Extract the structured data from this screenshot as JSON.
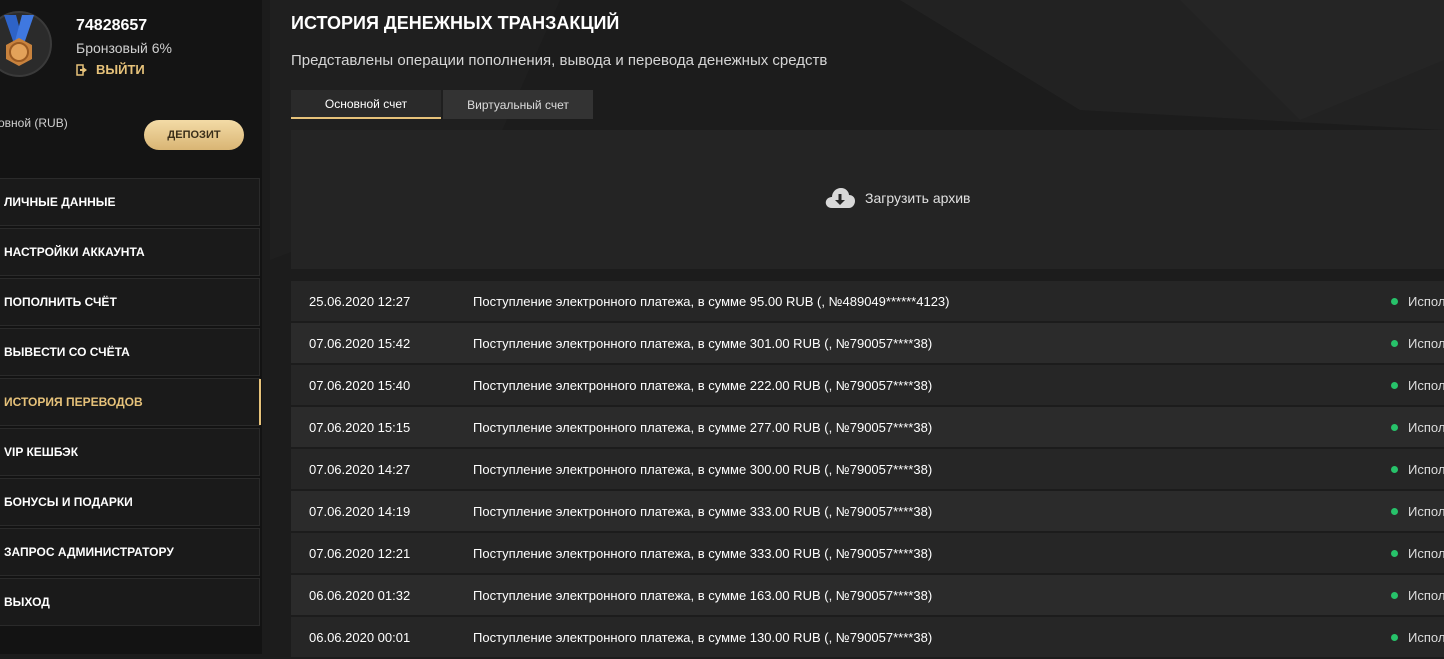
{
  "profile": {
    "user_id": "74828657",
    "level": "Бронзовый 6%",
    "logout_label": "ВЫЙТИ",
    "account_label": "овной (RUB)",
    "deposit_label": "ДЕПОЗИТ"
  },
  "nav": {
    "items": [
      {
        "label": "ЛИЧНЫЕ ДАННЫЕ"
      },
      {
        "label": "НАСТРОЙКИ АККАУНТА"
      },
      {
        "label": "ПОПОЛНИТЬ СЧЁТ"
      },
      {
        "label": "ВЫВЕСТИ СО СЧЁТА"
      },
      {
        "label": "ИСТОРИЯ ПЕРЕВОДОВ"
      },
      {
        "label": "VIP КЕШБЭК"
      },
      {
        "label": "БОНУСЫ И ПОДАРКИ"
      },
      {
        "label": "ЗАПРОС АДМИНИСТРАТОРУ"
      },
      {
        "label": "ВЫХОД"
      }
    ],
    "active_index": 4
  },
  "main": {
    "title": "ИСТОРИЯ ДЕНЕЖНЫХ ТРАНЗАКЦИЙ",
    "subtitle": "Представлены операции пополнения, вывода и перевода денежных средств",
    "tabs": [
      {
        "label": "Основной счет"
      },
      {
        "label": "Виртуальный счет"
      }
    ],
    "archive_label": "Загрузить архив"
  },
  "transactions": [
    {
      "date": "25.06.2020 12:27",
      "description": "Поступление электронного платежа, в сумме 95.00 RUB (, №489049******4123)",
      "status": "Испол"
    },
    {
      "date": "07.06.2020 15:42",
      "description": "Поступление электронного платежа, в сумме 301.00 RUB (, №790057****38)",
      "status": "Испол"
    },
    {
      "date": "07.06.2020 15:40",
      "description": "Поступление электронного платежа, в сумме 222.00 RUB (, №790057****38)",
      "status": "Испол"
    },
    {
      "date": "07.06.2020 15:15",
      "description": "Поступление электронного платежа, в сумме 277.00 RUB (, №790057****38)",
      "status": "Испол"
    },
    {
      "date": "07.06.2020 14:27",
      "description": "Поступление электронного платежа, в сумме 300.00 RUB (, №790057****38)",
      "status": "Испол"
    },
    {
      "date": "07.06.2020 14:19",
      "description": "Поступление электронного платежа, в сумме 333.00 RUB (, №790057****38)",
      "status": "Испол"
    },
    {
      "date": "07.06.2020 12:21",
      "description": "Поступление электронного платежа, в сумме 333.00 RUB (, №790057****38)",
      "status": "Испол"
    },
    {
      "date": "06.06.2020 01:32",
      "description": "Поступление электронного платежа, в сумме 163.00 RUB (, №790057****38)",
      "status": "Испол"
    },
    {
      "date": "06.06.2020 00:01",
      "description": "Поступление электронного платежа, в сумме 130.00 RUB (, №790057****38)",
      "status": "Испол"
    }
  ],
  "colors": {
    "accent": "#e6c27a",
    "status_ok": "#27c26a"
  }
}
